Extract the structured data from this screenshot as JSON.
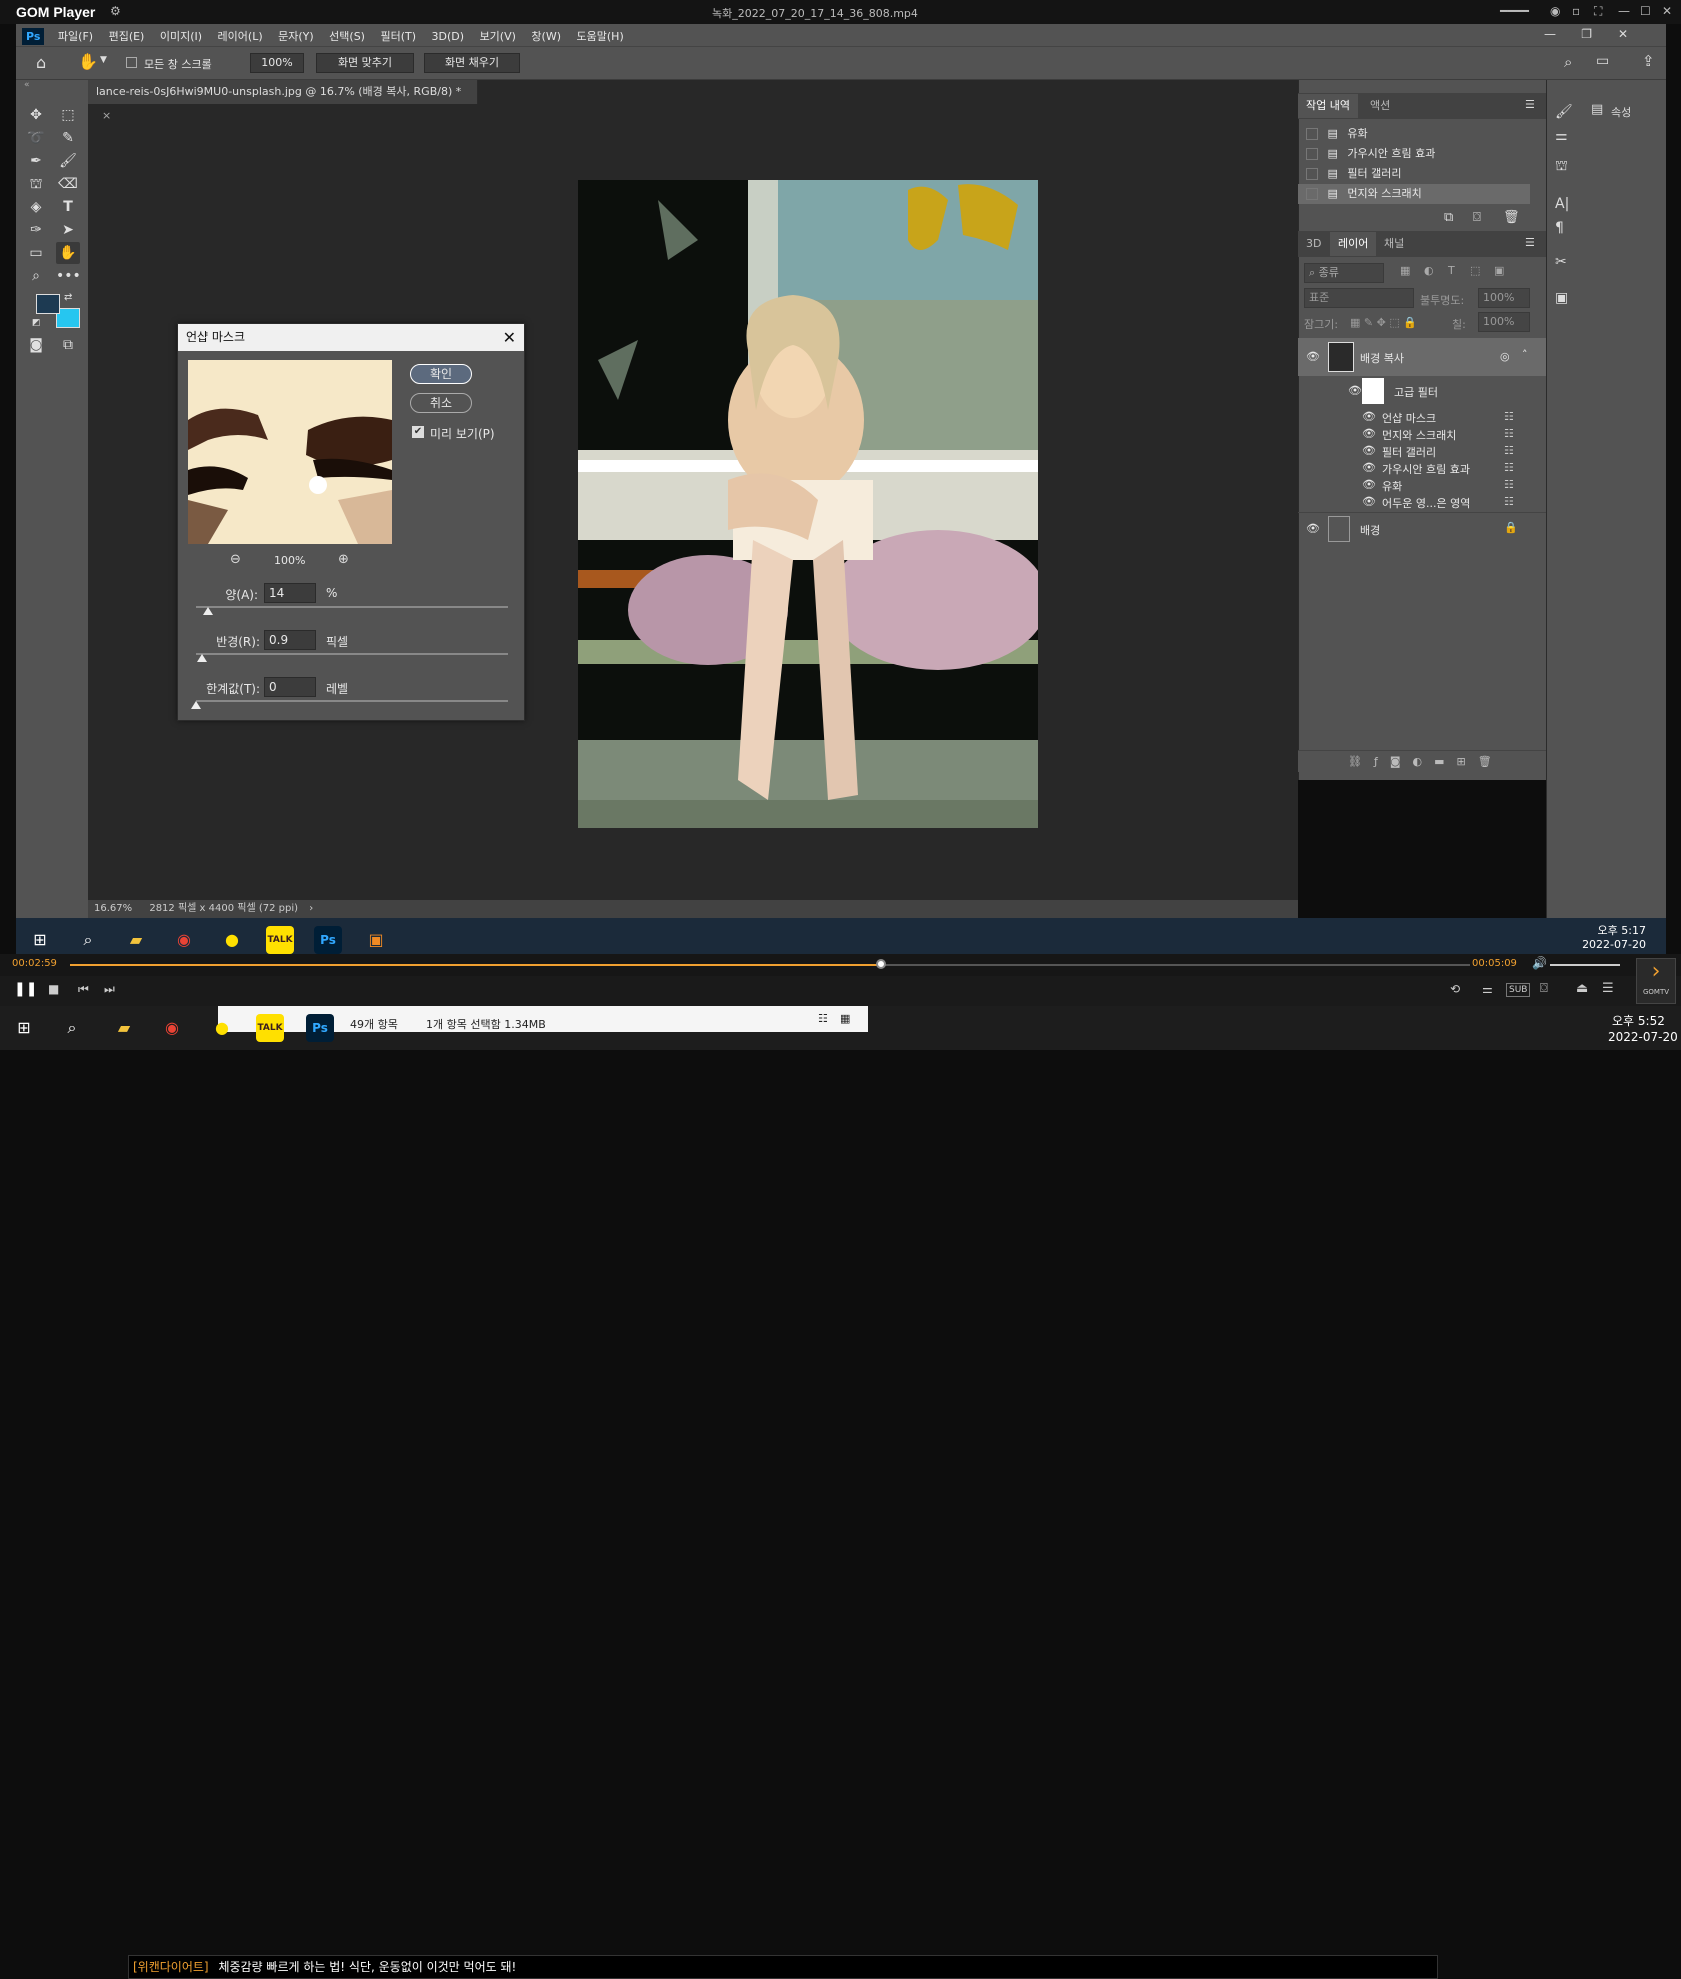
{
  "gom": {
    "app_name": "GOM Player",
    "file_name": "녹화_2022_07_20_17_14_36_808.mp4",
    "time_current": "00:02:59",
    "time_total": "00:05:09",
    "progress": 0.58,
    "ticker_tag": "[위캔다이어트]",
    "ticker_text": "체중감량 빠르게 하는 법! 식단, 운동없이 이것만 먹어도 돼!",
    "sub_label": "SUB",
    "gomtv_label": "GOMTV"
  },
  "ps": {
    "menu": [
      "Ps",
      "파일(F)",
      "편집(E)",
      "이미지(I)",
      "레이어(L)",
      "문자(Y)",
      "선택(S)",
      "필터(T)",
      "3D(D)",
      "보기(V)",
      "창(W)",
      "도움말(H)"
    ],
    "options": {
      "scroll_all": "모든 창 스크롤",
      "zoom_btn": "100%",
      "fit_screen": "화면 맞추기",
      "fill_screen": "화면 채우기"
    },
    "doc_tab": "lance-reis-0sJ6Hwi9MU0-unsplash.jpg @ 16.7% (배경 복사, RGB/8) *",
    "status_zoom": "16.67%",
    "status_size": "2812 픽셀 x 4400 픽셀 (72 ppi)",
    "history_tabs": [
      "작업 내역",
      "액션"
    ],
    "history": [
      "유화",
      "가우시안 흐림 효과",
      "필터 갤러리",
      "먼지와 스크래치"
    ],
    "layer_tabs": [
      "3D",
      "레이어",
      "채널"
    ],
    "layer_search": "종류",
    "blend_mode": "표준",
    "opacity_label": "불투명도:",
    "opacity_value": "100%",
    "lock_label": "잠그기:",
    "fill_label": "칠:",
    "fill_value": "100%",
    "layers": {
      "copy": "배경 복사",
      "smart_filter": "고급 필터",
      "filters": [
        "언샵 마스크",
        "먼지와 스크래치",
        "필터 갤러리",
        "가우시안 흐림 효과",
        "유화",
        "어두운 영...은 영역"
      ],
      "background": "배경"
    },
    "props_label": "속성",
    "colors": {
      "fg": "#1d3a52",
      "bg": "#26c6f0"
    }
  },
  "dialog": {
    "title": "언샵 마스크",
    "ok": "확인",
    "cancel": "취소",
    "preview_label": "미리 보기(P)",
    "preview_checked": true,
    "zoom": "100%",
    "amount_label": "양(A):",
    "amount": "14",
    "amount_unit": "%",
    "amount_level": 0.04,
    "radius_label": "반경(R):",
    "radius": "0.9",
    "radius_unit": "픽셀",
    "radius_level": 0.02,
    "threshold_label": "한계값(T):",
    "threshold": "0",
    "threshold_unit": "레벨",
    "threshold_level": 0
  },
  "taskbar_ps": {
    "time": "오후 5:17",
    "date": "2022-07-20"
  },
  "taskbar_win": {
    "time": "오후 5:52",
    "date": "2022-07-20",
    "explorer_count": "49개 항목",
    "explorer_sel": "1개 항목 선택함 1.34MB"
  }
}
